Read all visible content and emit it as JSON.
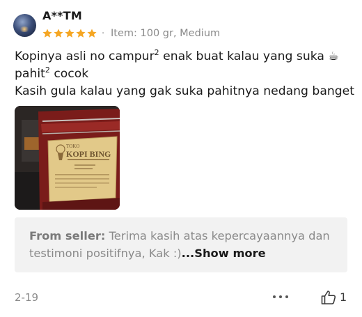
{
  "review": {
    "username": "A**TM",
    "rating": 5,
    "separator": "·",
    "item_info": "Item: 100 gr, Medium",
    "text_line1_a": "Kopinya asli no campur",
    "text_line1_sup": "2",
    "text_line1_b": " enak buat kalau yang suka ☕",
    "text_line2_a": "pahit",
    "text_line2_sup": "2",
    "text_line2_b": " cocok",
    "text_line3": "Kasih gula kalau yang gak suka pahitnya nedang banget",
    "date": "2-19",
    "like_count": "1"
  },
  "photo": {
    "brand_line1": "TOKO",
    "brand_line2": "KOPI BING"
  },
  "seller_reply": {
    "label": "From seller:",
    "text": " Terima kasih atas kepercayaannya dan testimoni positifnya, Kak :)",
    "show_more": "...Show more"
  },
  "colors": {
    "star": "#f5a623",
    "muted_text": "#8a8a8a",
    "reply_bg": "#f2f2f2"
  },
  "icons": [
    "star-icon",
    "more-options-icon",
    "thumbs-up-icon"
  ]
}
